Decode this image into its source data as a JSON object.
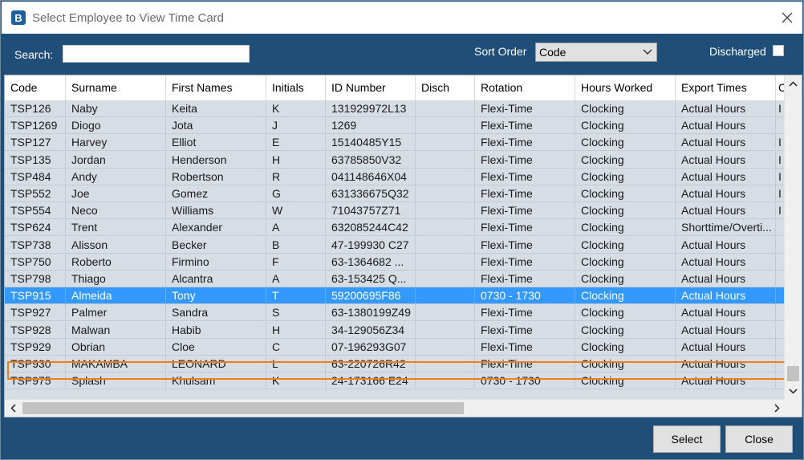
{
  "window": {
    "title": "Select Employee to View Time Card"
  },
  "toolbar": {
    "search_label": "Search:",
    "search_value": "",
    "sort_label": "Sort Order",
    "sort_value": "Code",
    "discharged_label": "Discharged",
    "discharged_checked": false
  },
  "grid": {
    "columns": [
      "Code",
      "Surname",
      "First Names",
      "Initials",
      "ID Number",
      "Disch",
      "Rotation",
      "Hours Worked",
      "Export Times",
      "C"
    ],
    "rows": [
      [
        "TSP126",
        "Naby",
        "Keita",
        "K",
        "131929972L13",
        "",
        "Flexi-Time",
        "Clocking",
        "Actual Hours",
        "I"
      ],
      [
        "TSP1269",
        "Diogo",
        "Jota",
        "J",
        "1269",
        "",
        "Flexi-Time",
        "Clocking",
        "Actual Hours",
        ""
      ],
      [
        "TSP127",
        "Harvey",
        "Elliot",
        "E",
        "15140485Y15",
        "",
        "Flexi-Time",
        "Clocking",
        "Actual Hours",
        "I"
      ],
      [
        "TSP135",
        "Jordan",
        "Henderson",
        "H",
        "63785850V32",
        "",
        "Flexi-Time",
        "Clocking",
        "Actual Hours",
        "I"
      ],
      [
        "TSP484",
        "Andy",
        "Robertson",
        "R",
        "041148646X04",
        "",
        "Flexi-Time",
        "Clocking",
        "Actual Hours",
        "I"
      ],
      [
        "TSP552",
        "Joe",
        "Gomez",
        "G",
        "631336675Q32",
        "",
        "Flexi-Time",
        "Clocking",
        "Actual Hours",
        "I"
      ],
      [
        "TSP554",
        "Neco",
        "Williams",
        "W",
        "71043757Z71",
        "",
        "Flexi-Time",
        "Clocking",
        "Actual Hours",
        "I"
      ],
      [
        "TSP624",
        "Trent",
        "Alexander",
        "A",
        "632085244C42",
        "",
        "Flexi-Time",
        "Clocking",
        "Shorttime/Overti...",
        ""
      ],
      [
        "TSP738",
        "Alisson",
        "Becker",
        "B",
        "47-199930 C27",
        "",
        "Flexi-Time",
        "Clocking",
        "Actual Hours",
        ""
      ],
      [
        "TSP750",
        "Roberto",
        "Firmino",
        "F",
        "63-1364682 ...",
        "",
        "Flexi-Time",
        "Clocking",
        "Actual Hours",
        ""
      ],
      [
        "TSP798",
        "Thiago",
        "Alcantra",
        "A",
        "63-153425  Q...",
        "",
        "Flexi-Time",
        "Clocking",
        "Actual Hours",
        ""
      ],
      [
        "TSP915",
        "Almeida",
        "Tony",
        "T",
        "59200695F86",
        "",
        "0730 - 1730",
        "Clocking",
        "Actual Hours",
        ""
      ],
      [
        "TSP927",
        "Palmer",
        "Sandra",
        "S",
        "63-1380199Z49",
        "",
        "Flexi-Time",
        "Clocking",
        "Actual Hours",
        ""
      ],
      [
        "TSP928",
        "Malwan",
        "Habib",
        "H",
        "34-129056Z34",
        "",
        "Flexi-Time",
        "Clocking",
        "Actual Hours",
        ""
      ],
      [
        "TSP929",
        "Obrian",
        "Cloe",
        "C",
        "07-196293G07",
        "",
        "Flexi-Time",
        "Clocking",
        "Actual Hours",
        ""
      ],
      [
        "TSP930",
        "MAKAMBA",
        "LEONARD",
        "L",
        "63-220726R42",
        "",
        "Flexi-Time",
        "Clocking",
        "Actual Hours",
        ""
      ],
      [
        "TSP975",
        "Splash",
        "Khulsam",
        "K",
        "24-173166 E24",
        "",
        "0730 - 1730",
        "Clocking",
        "Actual Hours",
        ""
      ]
    ],
    "selected_row": 11
  },
  "footer": {
    "select_label": "Select",
    "close_label": "Close"
  },
  "colors": {
    "header_bg": "#1f4e79",
    "row_bg": "#d6dde4",
    "selected_bg": "#3399ff",
    "selection_outline": "#f07f1a"
  },
  "icons": [
    "app-icon",
    "close-icon",
    "chevron-down-icon",
    "scroll-up-icon",
    "scroll-down-icon",
    "scroll-left-icon",
    "scroll-right-icon"
  ]
}
